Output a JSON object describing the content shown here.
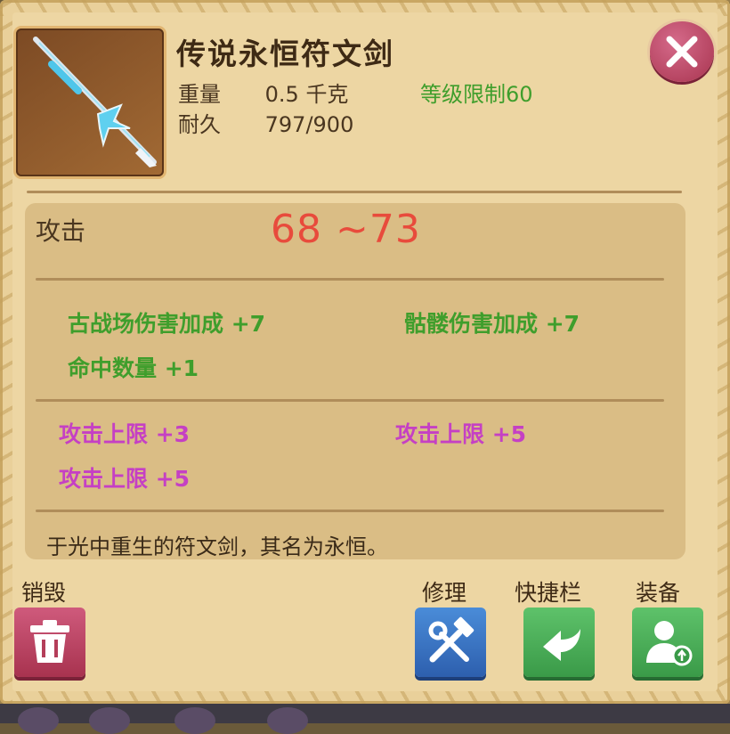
{
  "item": {
    "name": "传说永恒符文剑",
    "weight_label": "重量",
    "weight_value": "0.5 千克",
    "level_req": "等级限制60",
    "durability_label": "耐久",
    "durability_value": "797/900"
  },
  "attack": {
    "label": "攻击",
    "value": "68 ~73"
  },
  "bonuses_green": [
    "古战场伤害加成 +7",
    "骷髅伤害加成 +7",
    "命中数量 +1"
  ],
  "bonuses_magenta": [
    "攻击上限 +3",
    "攻击上限 +5",
    "攻击上限 +5"
  ],
  "description": "于光中重生的符文剑，其名为永恒。",
  "actions": {
    "destroy": "销毁",
    "repair": "修理",
    "quickbar": "快捷栏",
    "equip": "装备"
  },
  "icons": {
    "close": "close-icon",
    "destroy": "trash-icon",
    "repair": "hammer-wrench-icon",
    "quickbar": "arrow-left-icon",
    "equip": "user-badge-icon",
    "item": "sword-icon"
  },
  "colors": {
    "attack_value": "#e84b3c",
    "bonus_green": "#3f9e2c",
    "bonus_magenta": "#c540c4",
    "close_button": "#b8405e",
    "repair_button": "#3a74c4",
    "action_green": "#48ab55"
  }
}
